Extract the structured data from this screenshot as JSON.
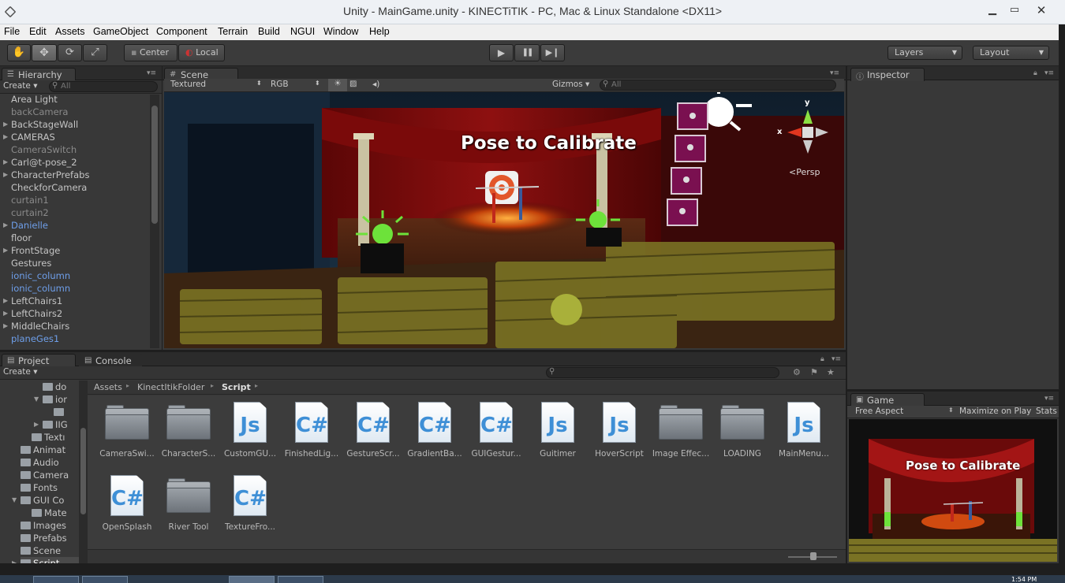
{
  "window": {
    "title": "Unity - MainGame.unity - KINECTiTIK - PC, Mac & Linux Standalone <DX11>",
    "minimize": "▁",
    "maximize": "▭",
    "close": "✕"
  },
  "menu": [
    "File",
    "Edit",
    "Assets",
    "GameObject",
    "Component",
    "Terrain",
    "Build",
    "NGUI",
    "Window",
    "Help"
  ],
  "toolbar": {
    "pivot_center": "Center",
    "pivot_local": "Local",
    "play": "▶",
    "pause": "❚❚",
    "step": "▶❙",
    "layers": "Layers",
    "layout": "Layout"
  },
  "hierarchy": {
    "tab": "Hierarchy",
    "create": "Create ▾",
    "search_placeholder": "All",
    "items": [
      {
        "label": "Area Light",
        "style": "normal",
        "expandable": false
      },
      {
        "label": "backCamera",
        "style": "grey",
        "expandable": false
      },
      {
        "label": "BackStageWall",
        "style": "normal",
        "expandable": true
      },
      {
        "label": "CAMERAS",
        "style": "normal",
        "expandable": true
      },
      {
        "label": "CameraSwitch",
        "style": "grey",
        "expandable": false
      },
      {
        "label": "Carl@t-pose_2",
        "style": "normal",
        "expandable": true
      },
      {
        "label": "CharacterPrefabs",
        "style": "normal",
        "expandable": true
      },
      {
        "label": "CheckforCamera",
        "style": "normal",
        "expandable": false
      },
      {
        "label": "curtain1",
        "style": "grey",
        "expandable": false
      },
      {
        "label": "curtain2",
        "style": "grey",
        "expandable": false
      },
      {
        "label": "Danielle",
        "style": "blue",
        "expandable": true
      },
      {
        "label": "floor",
        "style": "normal",
        "expandable": false
      },
      {
        "label": "FrontStage",
        "style": "normal",
        "expandable": true
      },
      {
        "label": "Gestures",
        "style": "normal",
        "expandable": false
      },
      {
        "label": "ionic_column",
        "style": "blue",
        "expandable": false
      },
      {
        "label": "ionic_column",
        "style": "blue",
        "expandable": false
      },
      {
        "label": "LeftChairs1",
        "style": "normal",
        "expandable": true
      },
      {
        "label": "LeftChairs2",
        "style": "normal",
        "expandable": true
      },
      {
        "label": "MiddleChairs",
        "style": "normal",
        "expandable": true
      },
      {
        "label": "planeGes1",
        "style": "blue",
        "expandable": false
      }
    ]
  },
  "scene": {
    "tab": "Scene",
    "render_mode": "Textured",
    "channel": "RGB",
    "gizmos": "Gizmos ▾",
    "search_placeholder": "All",
    "overlay_text": "Pose to Calibrate",
    "persp_label": "Persp",
    "axis_x": "x",
    "axis_y": "y"
  },
  "inspector": {
    "tab": "Inspector"
  },
  "project": {
    "tab": "Project",
    "console_tab": "Console",
    "create": "Create ▾",
    "breadcrumb": [
      "Assets",
      "KinectItikFolder",
      "Script"
    ],
    "tree": [
      {
        "label": "do",
        "indent": 3,
        "arrow": "",
        "folder": true
      },
      {
        "label": "ior",
        "indent": 3,
        "arrow": "▼",
        "folder": true
      },
      {
        "label": "",
        "indent": 4,
        "arrow": "",
        "folder": true
      },
      {
        "label": "IIG",
        "indent": 3,
        "arrow": "▶",
        "folder": true
      },
      {
        "label": "Textı",
        "indent": 2,
        "arrow": "",
        "folder": true
      },
      {
        "label": "Animat",
        "indent": 1,
        "arrow": "",
        "folder": true
      },
      {
        "label": "Audio",
        "indent": 1,
        "arrow": "",
        "folder": true
      },
      {
        "label": "Camera",
        "indent": 1,
        "arrow": "",
        "folder": true
      },
      {
        "label": "Fonts",
        "indent": 1,
        "arrow": "",
        "folder": true
      },
      {
        "label": "GUI Co",
        "indent": 1,
        "arrow": "▼",
        "folder": true
      },
      {
        "label": "Mate",
        "indent": 2,
        "arrow": "",
        "folder": true
      },
      {
        "label": "Images",
        "indent": 1,
        "arrow": "",
        "folder": true
      },
      {
        "label": "Prefabs",
        "indent": 1,
        "arrow": "",
        "folder": true
      },
      {
        "label": "Scene",
        "indent": 1,
        "arrow": "",
        "folder": true
      },
      {
        "label": "Script",
        "indent": 1,
        "arrow": "▶",
        "folder": true,
        "selected": true
      }
    ],
    "assets": [
      {
        "label": "CameraSwi...",
        "kind": "folder"
      },
      {
        "label": "CharacterS...",
        "kind": "folder"
      },
      {
        "label": "CustomGU...",
        "kind": "js"
      },
      {
        "label": "FinishedLig...",
        "kind": "cs"
      },
      {
        "label": "GestureScr...",
        "kind": "cs"
      },
      {
        "label": "GradientBa...",
        "kind": "cs"
      },
      {
        "label": "GUIGestur...",
        "kind": "cs"
      },
      {
        "label": "Guitimer",
        "kind": "js"
      },
      {
        "label": "HoverScript",
        "kind": "js"
      },
      {
        "label": "Image Effec...",
        "kind": "folder"
      },
      {
        "label": "LOADING",
        "kind": "folder"
      },
      {
        "label": "MainMenu...",
        "kind": "js"
      },
      {
        "label": "OpenSplash",
        "kind": "cs"
      },
      {
        "label": "River Tool",
        "kind": "folder"
      },
      {
        "label": "TextureFro...",
        "kind": "cs"
      }
    ],
    "icon_text": {
      "js": "Js",
      "cs": "C#"
    }
  },
  "game": {
    "tab": "Game",
    "aspect": "Free Aspect",
    "maximize": "Maximize on Play",
    "stats": "Stats",
    "overlay_text": "Pose to Calibrate"
  },
  "taskbar": {
    "clock": "1:54 PM"
  }
}
